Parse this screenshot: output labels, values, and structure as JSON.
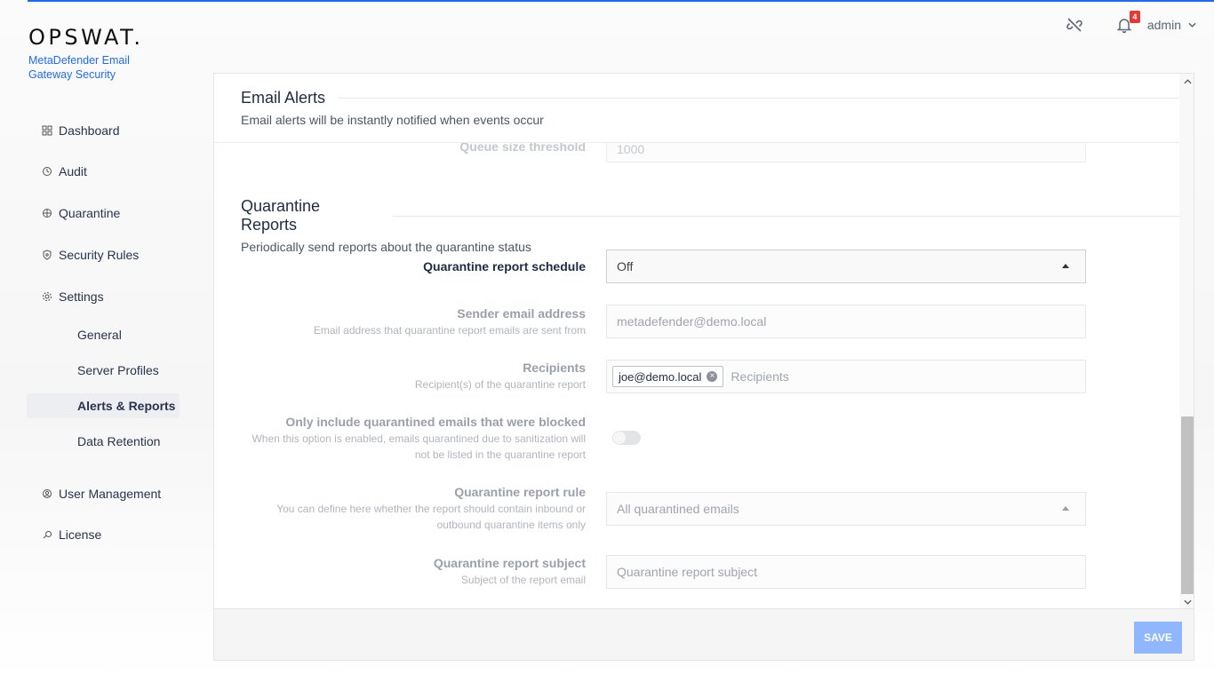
{
  "brand": {
    "logo": "OPSWAT.",
    "product": "MetaDefender Email Gateway Security"
  },
  "header": {
    "notification_count": "4",
    "user": "admin"
  },
  "sidebar": {
    "items": [
      {
        "label": "Dashboard",
        "icon": "dashboard-icon"
      },
      {
        "label": "Audit",
        "icon": "audit-icon"
      },
      {
        "label": "Quarantine",
        "icon": "quarantine-icon"
      },
      {
        "label": "Security Rules",
        "icon": "shield-icon"
      },
      {
        "label": "Settings",
        "icon": "gear-icon"
      }
    ],
    "settings_sub": [
      {
        "label": "General"
      },
      {
        "label": "Server Profiles"
      },
      {
        "label": "Alerts & Reports",
        "active": true
      },
      {
        "label": "Data Retention"
      }
    ],
    "bottom_items": [
      {
        "label": "User Management",
        "icon": "user-management-icon"
      },
      {
        "label": "License",
        "icon": "license-icon"
      }
    ]
  },
  "email_alerts": {
    "title": "Email Alerts",
    "description": "Email alerts will be instantly notified when events occur",
    "queue_label": "Queue size threshold",
    "queue_value": "1000"
  },
  "quarantine_reports": {
    "title": "Quarantine Reports",
    "description": "Periodically send reports about the quarantine status",
    "schedule": {
      "label": "Quarantine report schedule",
      "value": "Off"
    },
    "sender": {
      "label": "Sender email address",
      "hint": "Email address that quarantine report emails are sent from",
      "value": "metadefender@demo.local"
    },
    "recipients": {
      "label": "Recipients",
      "hint": "Recipient(s) of the quarantine report",
      "tag": "joe@demo.local",
      "placeholder": "Recipients"
    },
    "blocked_only": {
      "label": "Only include quarantined emails that were blocked",
      "hint_line1": "When this option is enabled, emails quarantined due to sanitization will",
      "hint_line2": "not be listed in the quarantine report",
      "enabled": false
    },
    "rule": {
      "label": "Quarantine report rule",
      "hint_line1": "You can define here whether the report should contain inbound or",
      "hint_line2": "outbound quarantine items only",
      "value": "All quarantined emails"
    },
    "subject": {
      "label": "Quarantine report subject",
      "hint": "Subject of the report email",
      "placeholder": "Quarantine report subject"
    }
  },
  "footer": {
    "save_label": "SAVE"
  },
  "colors": {
    "accent": "#1d6bfc",
    "save_disabled": "#8fb6ff",
    "badge": "#e53935"
  }
}
